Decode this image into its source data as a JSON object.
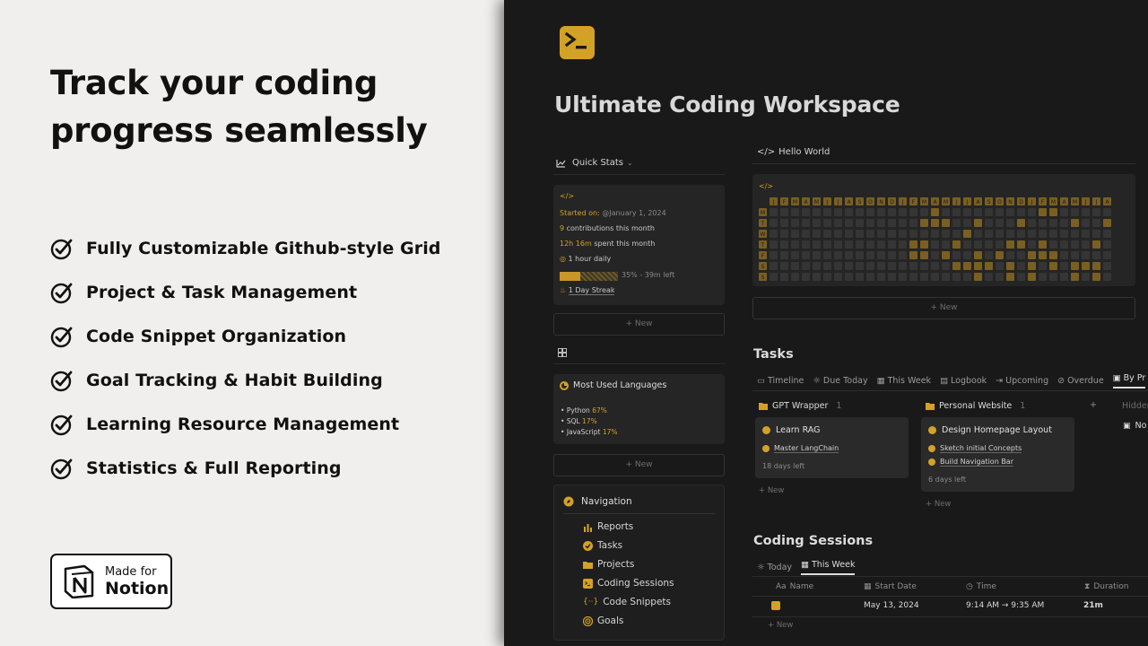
{
  "promo": {
    "title": "Track your coding progress seamlessly",
    "features": [
      "Fully Customizable Github-style Grid",
      "Project & Task Management",
      "Code Snippet Organization",
      "Goal Tracking & Habit Building",
      "Learning Resource Management",
      "Statistics & Full Reporting"
    ],
    "badge": {
      "line1": "Made for",
      "line2": "Notion"
    }
  },
  "workspace": {
    "title": "Ultimate Coding Workspace",
    "accent": "#d4a127",
    "quick_stats": {
      "heading": "Quick Stats",
      "code_symbol": "</>",
      "started_label": "Started on:",
      "started_value": "@January 1, 2024",
      "contrib_count": "9",
      "contrib_label": "contributions this month",
      "time_value": "12h 16m",
      "time_label": "spent this month",
      "daily_goal": "1 hour daily",
      "progress_percent": 35,
      "progress_text": "35% - 39m left",
      "streak": "1 Day Streak",
      "new_label": "+ New"
    },
    "languages": {
      "heading": "Most Used Languages",
      "items": [
        {
          "name": "Python",
          "pct": "67%"
        },
        {
          "name": "SQL",
          "pct": "17%"
        },
        {
          "name": "JavaScript",
          "pct": "17%"
        }
      ],
      "new_label": "+ New"
    },
    "navigation": {
      "heading": "Navigation",
      "items": [
        "Reports",
        "Tasks",
        "Projects",
        "Coding Sessions",
        "Code Snippets",
        "Goals"
      ]
    },
    "hello_world": {
      "heading": "Hello World",
      "code_symbol": "</>",
      "day_labels": [
        "M",
        "T",
        "W",
        "T",
        "F",
        "S",
        "S"
      ],
      "week_headers": [
        "J",
        "F",
        "M",
        "A",
        "M",
        "J",
        "J",
        "A",
        "S",
        "O",
        "N",
        "D",
        "J",
        "F",
        "M",
        "A",
        "M",
        "J",
        "J",
        "A",
        "S",
        "O",
        "N",
        "D",
        "J",
        "F",
        "M",
        "A",
        "M",
        "J",
        "J",
        "A"
      ],
      "new_label": "+ New"
    },
    "tasks": {
      "heading": "Tasks",
      "tabs": [
        "Timeline",
        "Due Today",
        "This Week",
        "Logbook",
        "Upcoming",
        "Overdue",
        "By Pr"
      ],
      "active_tab": "By Pr",
      "groups": [
        {
          "name": "GPT Wrapper",
          "count": "1",
          "card_title": "Learn RAG",
          "subtasks": [
            "Master LangChain"
          ],
          "days": "18 days left"
        },
        {
          "name": "Personal Website",
          "count": "1",
          "card_title": "Design Homepage Layout",
          "subtasks": [
            "Sketch initial Concepts",
            "Build Navigation Bar"
          ],
          "days": "6 days left"
        }
      ],
      "hidden_label": "Hidden",
      "hidden_item": "No",
      "add_symbol": "+",
      "new_label": "+ New"
    },
    "coding_sessions": {
      "heading": "Coding Sessions",
      "tabs": [
        "Today",
        "This Week"
      ],
      "active_tab": "This Week",
      "columns": [
        "Name",
        "Start Date",
        "Time",
        "Duration"
      ],
      "rows": [
        {
          "start_date": "May 13, 2024",
          "time": "9:14 AM → 9:35 AM",
          "duration": "21m"
        }
      ],
      "new_label": "+ New"
    }
  }
}
